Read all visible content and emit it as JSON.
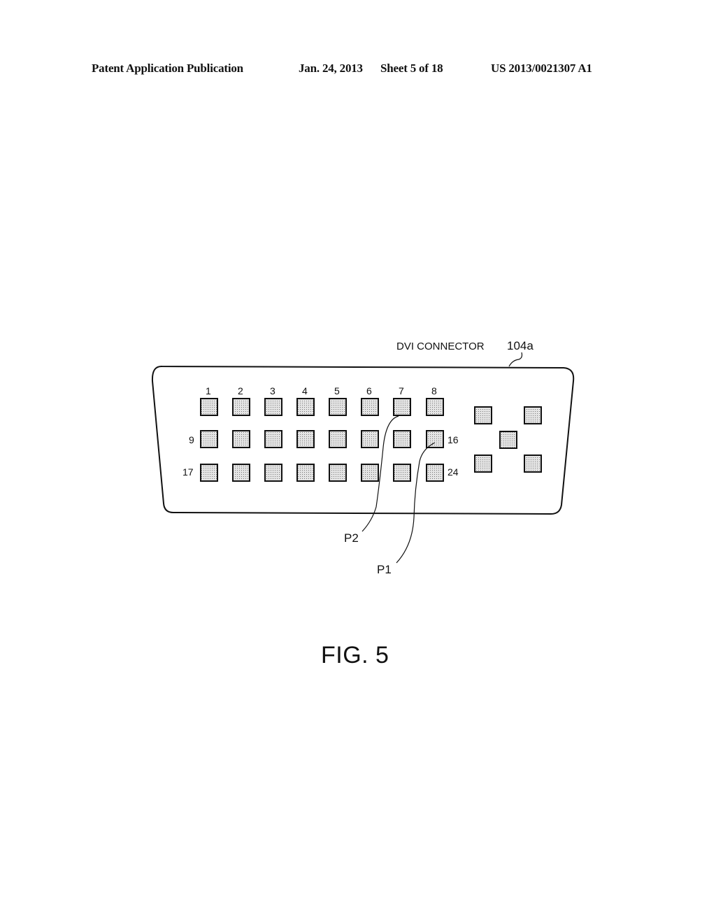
{
  "header": {
    "publication": "Patent Application Publication",
    "date": "Jan. 24, 2013",
    "sheet": "Sheet 5 of 18",
    "number": "US 2013/0021307 A1"
  },
  "figure": {
    "connector_label": "DVI CONNECTOR",
    "connector_ref": "104a",
    "pin_numbers_top": [
      "1",
      "2",
      "3",
      "4",
      "5",
      "6",
      "7",
      "8"
    ],
    "row_labels": {
      "row2_left": "9",
      "row2_right": "16",
      "row3_left": "17",
      "row3_right": "24"
    },
    "callouts": {
      "p1": "P1",
      "p2": "P2"
    },
    "caption": "FIG. 5",
    "pin_fill": "#c8c8c8",
    "line_color": "#111111"
  }
}
